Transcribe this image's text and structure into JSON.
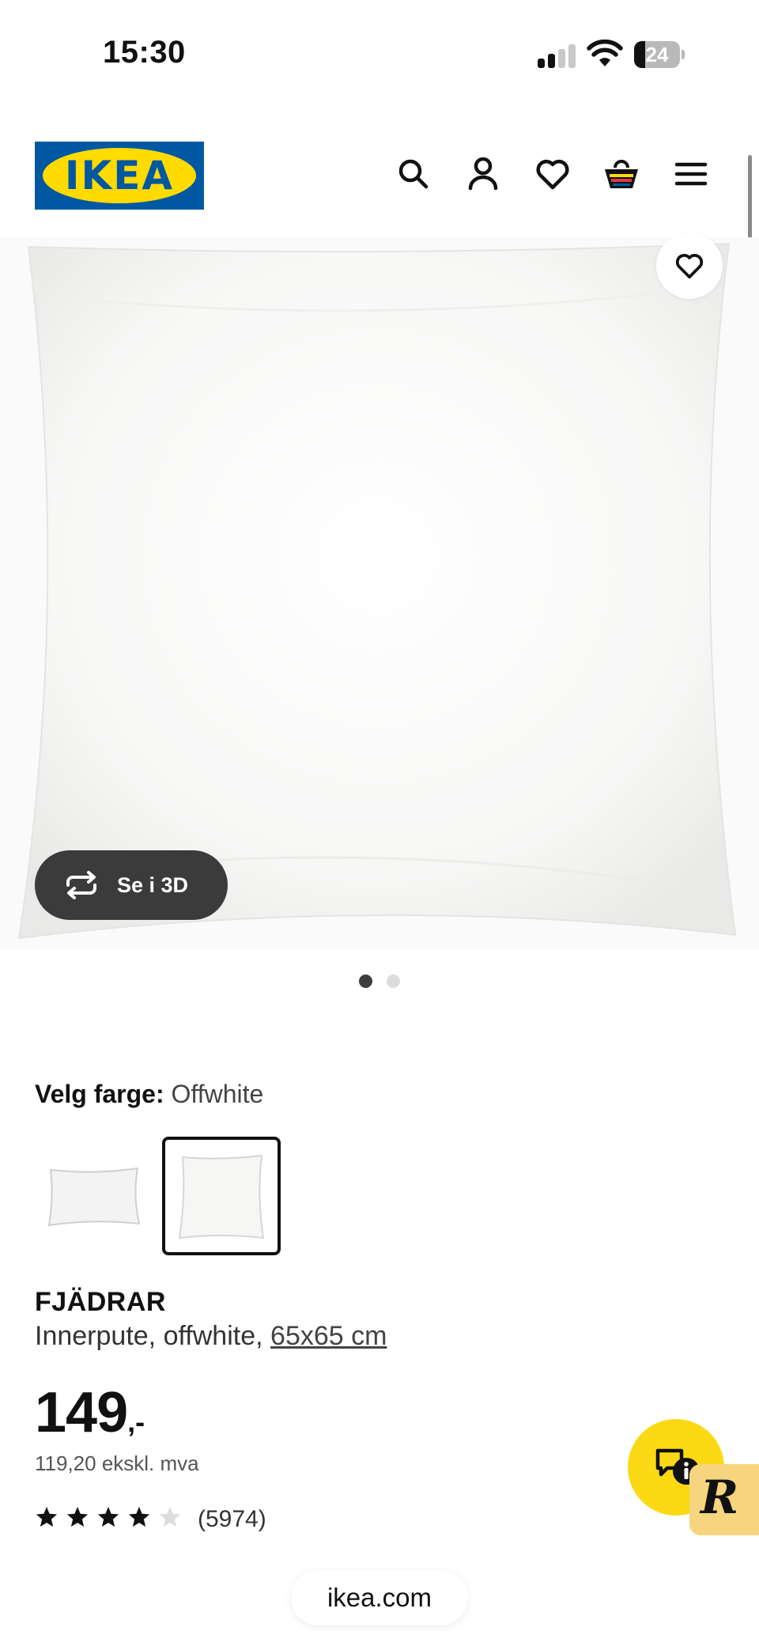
{
  "status_bar": {
    "time": "15:30",
    "battery_level": "24",
    "battery_fraction": 0.24,
    "icons": [
      "cellular-signal-icon",
      "wifi-icon",
      "battery-icon"
    ]
  },
  "header": {
    "logo_text": "IKEA",
    "logo_colors": {
      "blue": "#0058a3",
      "yellow": "#ffdb00"
    },
    "icons": [
      "search-icon",
      "account-icon",
      "heart-icon",
      "basket-icon",
      "menu-icon"
    ]
  },
  "gallery": {
    "view_3d_label": "Se i 3D",
    "current_image": 1,
    "image_count": 2
  },
  "color": {
    "label": "Velg farge:",
    "selected": "Offwhite"
  },
  "product": {
    "name": "FJÄDRAR",
    "description": "Innerpute, offwhite,",
    "size": "65x65 cm",
    "price": "149",
    "price_suffix": ",-",
    "price_ex_vat": "119,20 ekskl. mva",
    "rating_stars": 4,
    "rating_max": 5,
    "rating_count": "(5974)"
  },
  "floating": {
    "chat_icon": "chat-info-icon",
    "badge_text": "R"
  },
  "browser": {
    "url": "ikea.com"
  },
  "colors": {
    "accent_yellow": "#fbd914",
    "text": "#111111",
    "pill_dark": "#3b3b3b"
  }
}
